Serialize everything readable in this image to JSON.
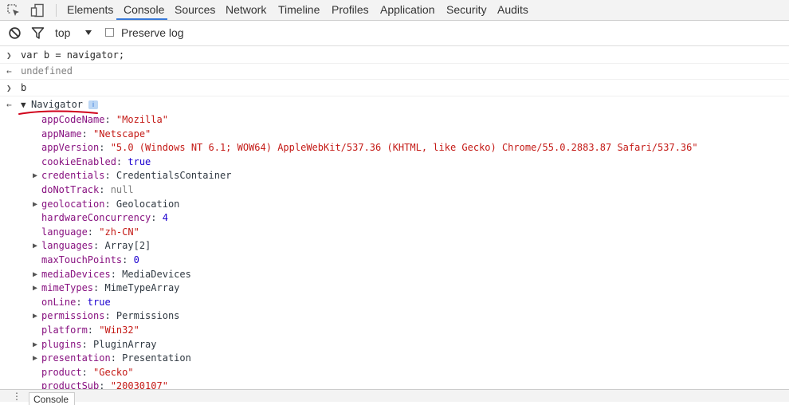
{
  "tabs": [
    {
      "label": "Elements"
    },
    {
      "label": "Console",
      "active": true
    },
    {
      "label": "Sources"
    },
    {
      "label": "Network"
    },
    {
      "label": "Timeline"
    },
    {
      "label": "Profiles"
    },
    {
      "label": "Application"
    },
    {
      "label": "Security"
    },
    {
      "label": "Audits"
    }
  ],
  "toolbar": {
    "context": "top",
    "preserve_log_label": "Preserve log",
    "preserve_log_checked": false
  },
  "console": {
    "input1": "var b = navigator;",
    "output1": "undefined",
    "input2": "b",
    "object_name": "Navigator",
    "info_badge": "i",
    "properties": [
      {
        "key": "appCodeName",
        "value": "\"Mozilla\"",
        "type": "str"
      },
      {
        "key": "appName",
        "value": "\"Netscape\"",
        "type": "str"
      },
      {
        "key": "appVersion",
        "value": "\"5.0 (Windows NT 6.1; WOW64) AppleWebKit/537.36 (KHTML, like Gecko) Chrome/55.0.2883.87 Safari/537.36\"",
        "type": "str"
      },
      {
        "key": "cookieEnabled",
        "value": "true",
        "type": "bool"
      },
      {
        "key": "credentials",
        "value": "CredentialsContainer",
        "type": "obj",
        "expandable": true
      },
      {
        "key": "doNotTrack",
        "value": "null",
        "type": "nul"
      },
      {
        "key": "geolocation",
        "value": "Geolocation",
        "type": "obj",
        "expandable": true
      },
      {
        "key": "hardwareConcurrency",
        "value": "4",
        "type": "num"
      },
      {
        "key": "language",
        "value": "\"zh-CN\"",
        "type": "str"
      },
      {
        "key": "languages",
        "value": "Array[2]",
        "type": "obj",
        "expandable": true
      },
      {
        "key": "maxTouchPoints",
        "value": "0",
        "type": "num"
      },
      {
        "key": "mediaDevices",
        "value": "MediaDevices",
        "type": "obj",
        "expandable": true
      },
      {
        "key": "mimeTypes",
        "value": "MimeTypeArray",
        "type": "obj",
        "expandable": true
      },
      {
        "key": "onLine",
        "value": "true",
        "type": "bool"
      },
      {
        "key": "permissions",
        "value": "Permissions",
        "type": "obj",
        "expandable": true
      },
      {
        "key": "platform",
        "value": "\"Win32\"",
        "type": "str"
      },
      {
        "key": "plugins",
        "value": "PluginArray",
        "type": "obj",
        "expandable": true
      },
      {
        "key": "presentation",
        "value": "Presentation",
        "type": "obj",
        "expandable": true
      },
      {
        "key": "product",
        "value": "\"Gecko\"",
        "type": "str"
      },
      {
        "key": "productSub",
        "value": "\"20030107\"",
        "type": "str"
      }
    ]
  },
  "drawer": {
    "tab_label": "Console"
  },
  "colors": {
    "accent": "#3879d9",
    "annotation": "#d0021b"
  }
}
